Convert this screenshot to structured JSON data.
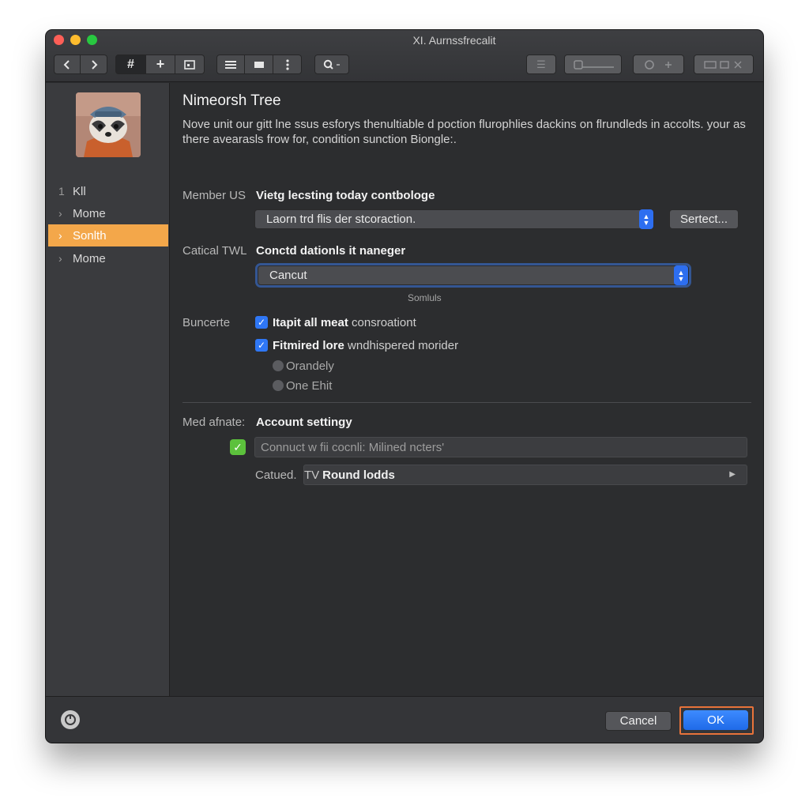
{
  "window": {
    "title": "XI. Aurnssfrecalit"
  },
  "toolbar": {
    "back_icon": "chevron-left-icon",
    "forward_icon": "chevron-right-icon",
    "grid_icon": "hash-icon",
    "add_icon": "plus-icon",
    "frame_icon": "frame-icon",
    "list_icon": "list-icon",
    "card_icon": "card-icon",
    "more_icon": "more-vertical-icon",
    "search_icon": "search-icon"
  },
  "sidebar": {
    "items": [
      {
        "prefix": "1",
        "label": "Kll",
        "active": false
      },
      {
        "prefix": "›",
        "label": "Mome",
        "active": false
      },
      {
        "prefix": "›",
        "label": "Sonlth",
        "active": true
      },
      {
        "prefix": "›",
        "label": "Mome",
        "active": false
      }
    ]
  },
  "main": {
    "title": "Nimeorsh Tree",
    "description": "Nove unit our gitt lne ssus esforys thenultiable d poction flurophlies dackins on flrundleds in accolts. your as there avearasls frow for, condition sunction Biongle:.",
    "member": {
      "label": "Member US",
      "heading": "Vietg lecsting today contbologe",
      "select_value": "Laorn trd flis der stcoraction.",
      "button_label": "Sertect..."
    },
    "catical": {
      "label": "Catical TWL",
      "heading": "Conctd dationls it naneger",
      "select_value": "Cancut",
      "hint": "Somluls"
    },
    "buncerte": {
      "label": "Buncerte",
      "checks": [
        {
          "bold": "Itapit all meat",
          "rest": " consroationt",
          "checked": true
        },
        {
          "bold": "Fitmired lore",
          "rest": " wndhispered morider",
          "checked": true
        }
      ],
      "radios": [
        "Orandely",
        "One Ehit"
      ]
    },
    "account": {
      "label": "Med afnate:",
      "heading": "Account settingy",
      "field_value": "Connuct w fii cocnli: Milined ncters'",
      "catued_label": "Catued.",
      "popup_prefix": "TV",
      "popup_value": "Round lodds"
    }
  },
  "footer": {
    "help_icon": "help-circle-icon",
    "cancel_label": "Cancel",
    "ok_label": "OK"
  },
  "colors": {
    "accent_blue": "#2f77f5",
    "sidebar_selection": "#f3a74a",
    "ok_highlight": "#e8733a",
    "check_green": "#5cc13c"
  }
}
